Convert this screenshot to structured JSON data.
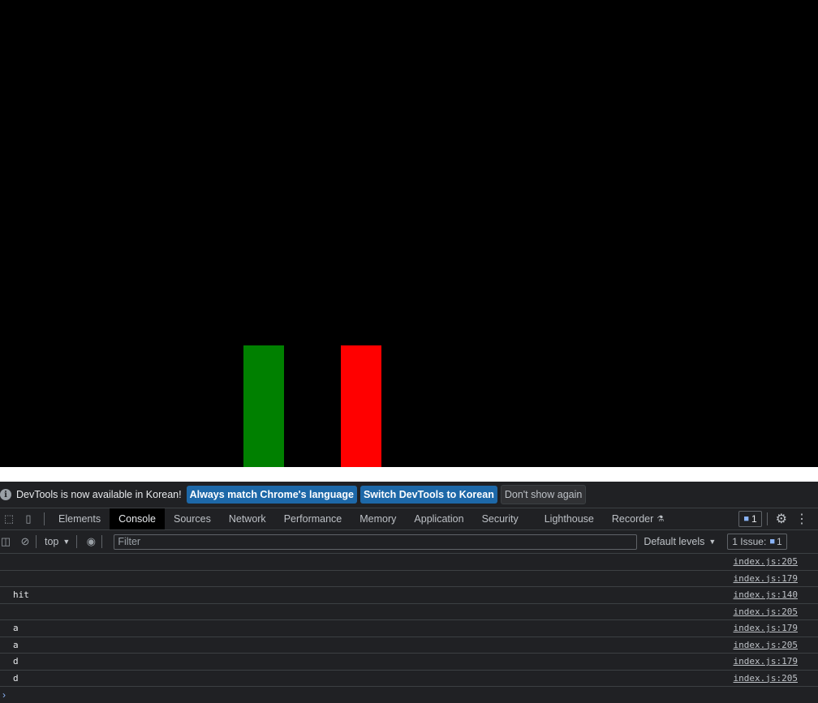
{
  "infobar": {
    "message": "DevTools is now available in Korean!",
    "buttons": [
      "Always match Chrome's language",
      "Switch DevTools to Korean",
      "Don't show again"
    ]
  },
  "tabs": [
    "Elements",
    "Console",
    "Sources",
    "Network",
    "Performance",
    "Memory",
    "Application",
    "Security",
    "Lighthouse",
    "Recorder"
  ],
  "active_tab": "Console",
  "message_count": "1",
  "toolbar": {
    "context": "top",
    "filter_placeholder": "Filter",
    "levels": "Default levels",
    "issues_label": "1 Issue:",
    "issues_count": "1"
  },
  "console_rows": [
    {
      "message": "",
      "source": "index.js:205"
    },
    {
      "message": "",
      "source": "index.js:179"
    },
    {
      "message": "hit",
      "source": "index.js:140"
    },
    {
      "message": "",
      "source": "index.js:205"
    },
    {
      "message": "a",
      "source": "index.js:179"
    },
    {
      "message": "a",
      "source": "index.js:205"
    },
    {
      "message": "d",
      "source": "index.js:179"
    },
    {
      "message": "d",
      "source": "index.js:205"
    }
  ],
  "prompt_symbol": "›",
  "colors": {
    "green_block": "#008000",
    "red_block": "#ff0000",
    "game_bg": "#000000"
  }
}
